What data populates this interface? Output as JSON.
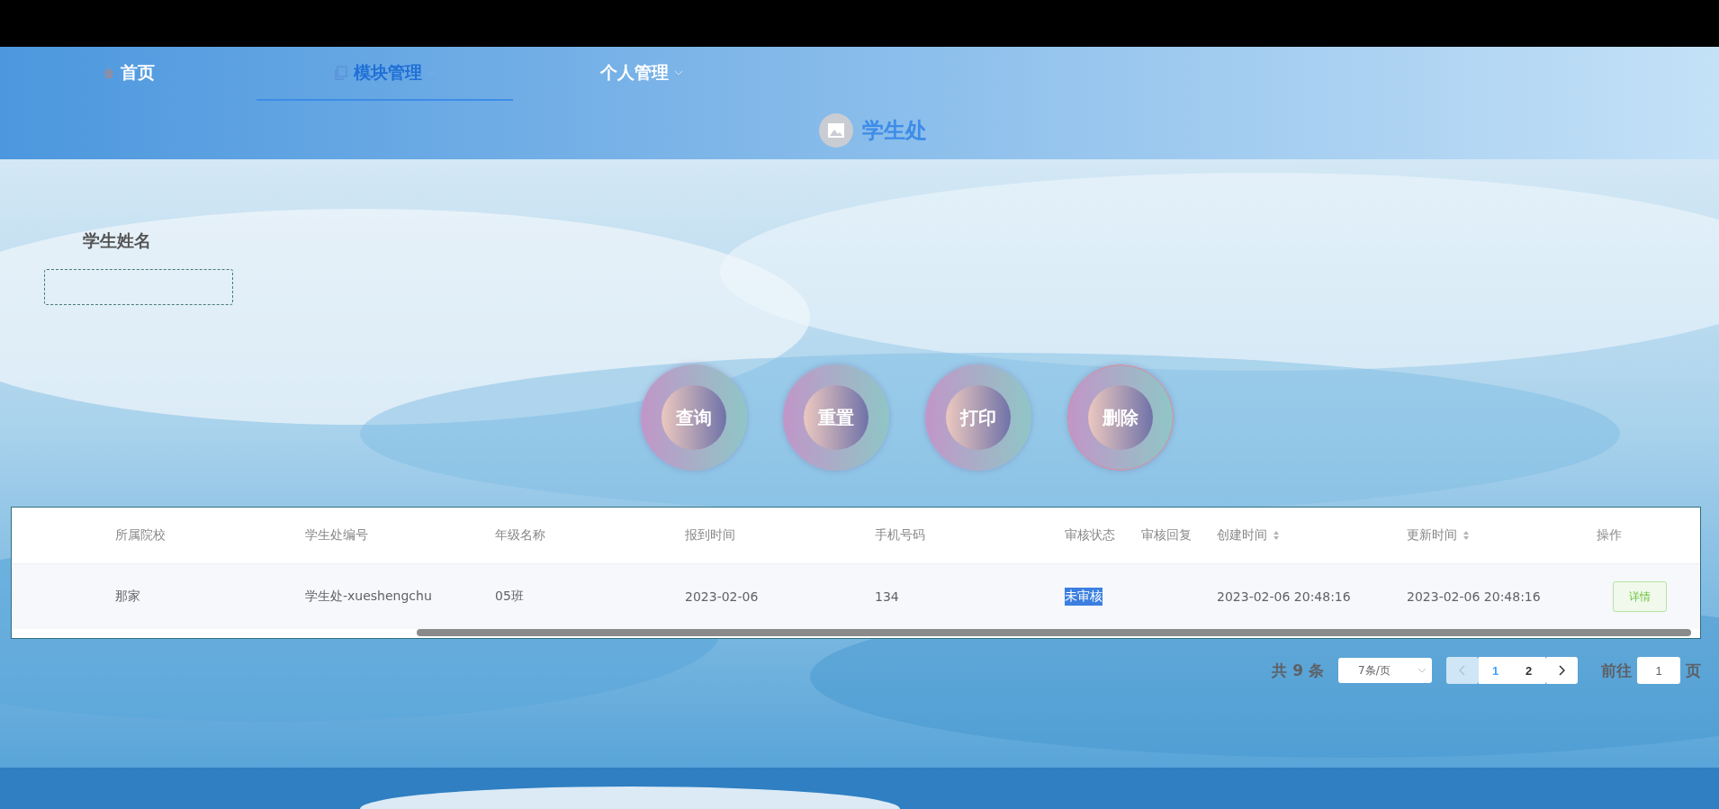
{
  "nav": {
    "items": [
      {
        "label": "首页",
        "dropdown": false,
        "selected": false
      },
      {
        "label": "模块管理",
        "dropdown": true,
        "selected": true
      },
      {
        "label": "个人管理",
        "dropdown": true,
        "selected": false
      }
    ]
  },
  "page_title": "学生处",
  "search": {
    "fields": [
      {
        "label": "学生姓名"
      }
    ]
  },
  "actions": [
    "查询",
    "重置",
    "打印",
    "删除"
  ],
  "table": {
    "columns": [
      {
        "label": "所属院校",
        "sortable": false
      },
      {
        "label": "学生处编号",
        "sortable": false
      },
      {
        "label": "年级名称",
        "sortable": false
      },
      {
        "label": "报到时间",
        "sortable": false
      },
      {
        "label": "手机号码",
        "sortable": false
      },
      {
        "label": "审核状态",
        "sortable": false
      },
      {
        "label": "审核回复",
        "sortable": false
      },
      {
        "label": "创建时间",
        "sortable": true
      },
      {
        "label": "更新时间",
        "sortable": true
      },
      {
        "label": "操作",
        "sortable": false
      }
    ],
    "rows": [
      {
        "school": "那家",
        "office_no": "学生处-xueshengchu",
        "grade": "05班",
        "report_date": "2023-02-06",
        "phone": "134",
        "review_status": {
          "text": "未审核",
          "highlighted": true
        },
        "created": "2023-02-06 20:48:16",
        "updated": "2023-02-06 20:48:16",
        "action": "详情"
      }
    ]
  },
  "pagination": {
    "total": "共 9 条",
    "page_size": "7条/页",
    "prev_disabled": true,
    "pages": [
      {
        "label": "1",
        "selected": true
      },
      {
        "label": "2",
        "selected": false
      }
    ],
    "goto_label": "前往",
    "goto_value": "1",
    "goto_suffix": "页"
  }
}
